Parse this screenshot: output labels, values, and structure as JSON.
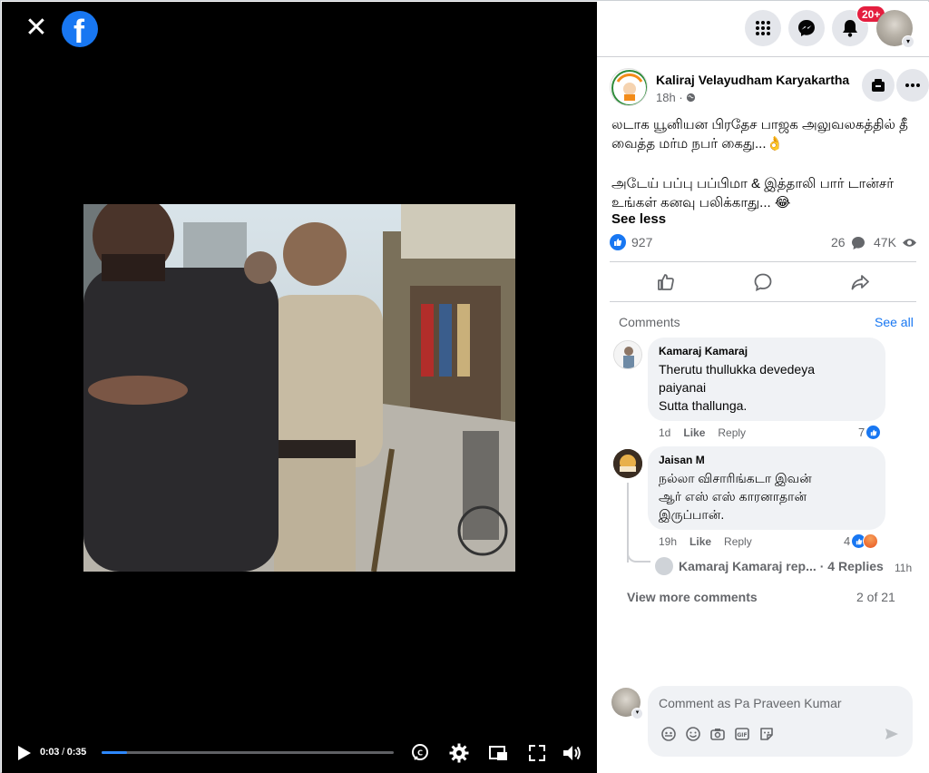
{
  "player": {
    "time_current": "0:03",
    "time_total": "0:35",
    "progress_fraction": 0.086
  },
  "notifications": {
    "badge": "20+"
  },
  "post": {
    "page_name": "Kaliraj Velayudham Karyakartha",
    "time": "18h",
    "text_line1": "லடாக யூனியன பிரதேச பாஜக அலுவலகத்தில் தீ வைத்த மர்ம நபர் கைது...👌",
    "text_line2": "அடேய் பப்பு பப்பிமா & இத்தாலி பார் டான்சர் உங்கள் கனவு பலிக்காது... 😂",
    "see_less": "See less",
    "reactions_count": "927",
    "comments_count": "26",
    "views_count": "47K"
  },
  "comments_section": {
    "heading": "Comments",
    "see_all": "See all",
    "comments": [
      {
        "author": "Kamaraj Kamaraj",
        "text": "Therutu thullukka devedeya\npaiyanai\nSutta thallunga.",
        "time": "1d",
        "like_label": "Like",
        "reply_label": "Reply",
        "reactions": "7"
      },
      {
        "author": "Jaisan M",
        "text": "நல்லா விசாரிங்கடா இவன்\nஆர் எஸ் எஸ் காரனாதான்\nஇருப்பான்.",
        "time": "19h",
        "like_label": "Like",
        "reply_label": "Reply",
        "reactions": "4"
      }
    ],
    "reply_preview": {
      "author": "Kamaraj Kamaraj rep...",
      "summary": "· 4 Replies",
      "time": "11h"
    },
    "view_more": "View more comments",
    "page_count": "2 of 21"
  },
  "composer": {
    "placeholder": "Comment as Pa Praveen Kumar"
  }
}
